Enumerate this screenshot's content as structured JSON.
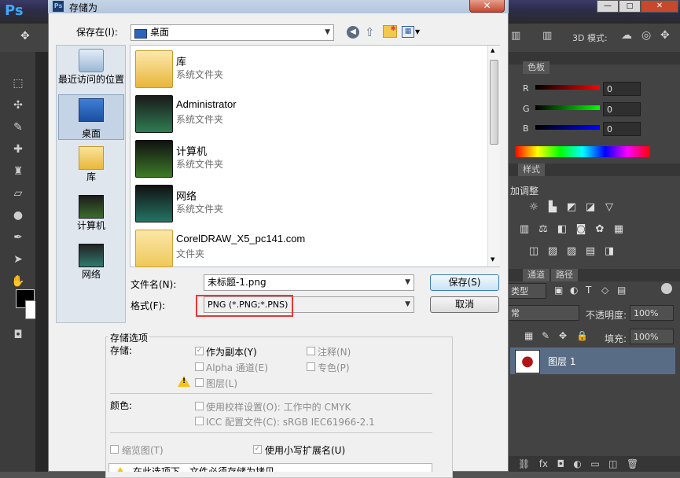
{
  "ps": {
    "logo": "Ps",
    "mode_3d": "3D 模式:",
    "panels": {
      "color_tab": "色板",
      "r_label": "R",
      "g_label": "G",
      "b_label": "B",
      "r_value": "0",
      "g_value": "0",
      "b_value": "0",
      "style_tab": "样式",
      "adjust_title": "加调整",
      "channels_tab": "通道",
      "paths_tab": "路径",
      "kind_select": "类型",
      "blend_select": "常",
      "opacity_label": "不透明度:",
      "opacity_value": "100%",
      "fill_label": "填充:",
      "fill_value": "100%",
      "layer_name": "图层 1"
    }
  },
  "dialog": {
    "title": "存储为",
    "close": "✕",
    "save_in_label": "保存在(I):",
    "save_in_value": "桌面",
    "places": [
      "最近访问的位置",
      "桌面",
      "库",
      "计算机",
      "网络"
    ],
    "files": [
      {
        "name": "库",
        "type": "系统文件夹"
      },
      {
        "name": "Administrator",
        "type": "系统文件夹"
      },
      {
        "name": "计算机",
        "type": "系统文件夹"
      },
      {
        "name": "网络",
        "type": "系统文件夹"
      },
      {
        "name": "CorelDRAW_X5_pc141.com",
        "type": "文件夹"
      }
    ],
    "filename_label": "文件名(N):",
    "filename_value": "未标题-1.png",
    "format_label": "格式(F):",
    "format_value": "PNG (*.PNG;*.PNS)",
    "save_button": "保存(S)",
    "cancel_button": "取消",
    "options": {
      "group_title": "存储选项",
      "store_label": "存储:",
      "as_copy": "作为副本(Y)",
      "annotations": "注释(N)",
      "alpha": "Alpha 通道(E)",
      "spot": "专色(P)",
      "layers": "图层(L)",
      "color_label": "颜色:",
      "proof": "使用校样设置(O):  工作中的 CMYK",
      "icc": "ICC 配置文件(C):  sRGB IEC61966-2.1",
      "thumbnail": "缩览图(T)",
      "lowercase": "使用小写扩展名(U)",
      "warning": "在此选项下，文件必须存储为拷贝。"
    }
  },
  "colors": {
    "highlight": "#e53935",
    "ps_dark": "#434343"
  }
}
